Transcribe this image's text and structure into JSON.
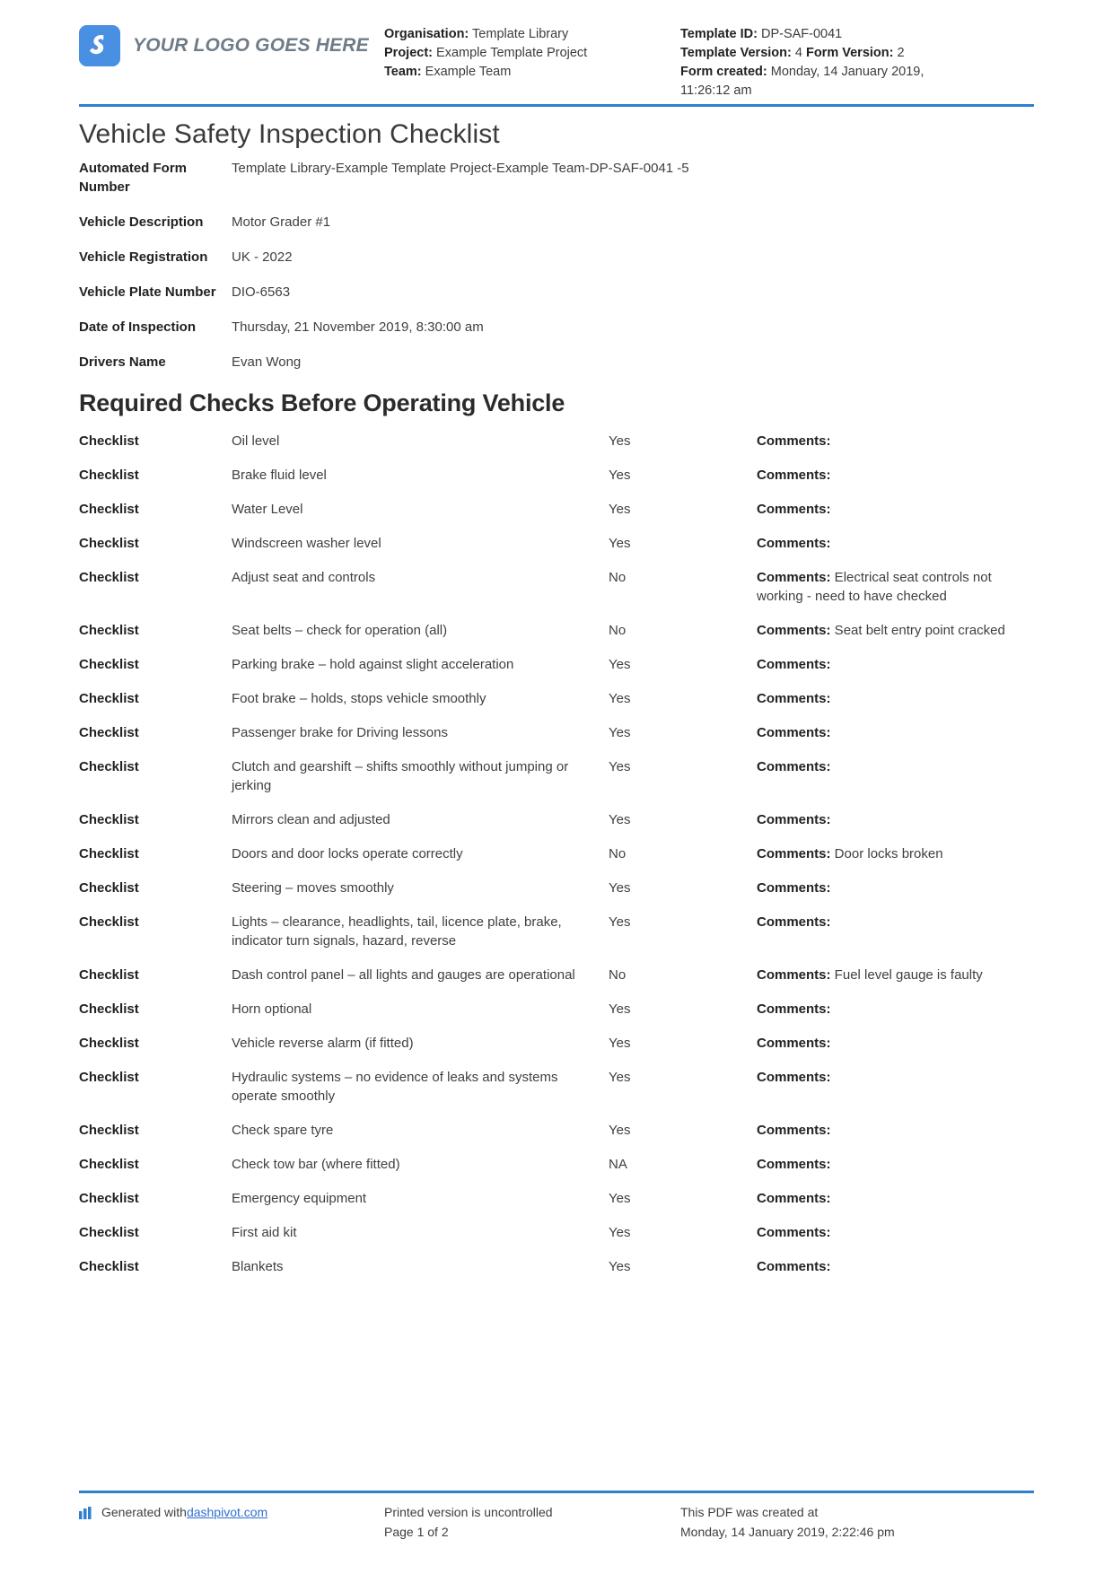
{
  "header": {
    "logo_text": "YOUR LOGO GOES HERE",
    "left_meta": [
      {
        "label": "Organisation:",
        "value": "Template Library"
      },
      {
        "label": "Project:",
        "value": "Example Template Project"
      },
      {
        "label": "Team:",
        "value": "Example Team"
      }
    ],
    "right_meta": [
      {
        "label": "Template ID:",
        "value": "DP-SAF-0041"
      },
      {
        "label": "Template Version:",
        "value": "4",
        "label2": "Form Version:",
        "value2": "2"
      },
      {
        "label": "Form created:",
        "value": "Monday, 14 January 2019, 11:26:12 am"
      }
    ]
  },
  "title": "Vehicle Safety Inspection Checklist",
  "fields": [
    {
      "label": "Automated Form Number",
      "value": "Template Library-Example Template Project-Example Team-DP-SAF-0041   -5"
    },
    {
      "label": "Vehicle Description",
      "value": "Motor Grader #1"
    },
    {
      "label": "Vehicle Registration",
      "value": "UK - 2022"
    },
    {
      "label": "Vehicle Plate Number",
      "value": "DIO-6563"
    },
    {
      "label": "Date of Inspection",
      "value": "Thursday, 21 November 2019, 8:30:00 am"
    },
    {
      "label": "Drivers Name",
      "value": "Evan Wong"
    }
  ],
  "section_heading": "Required Checks Before Operating Vehicle",
  "checklist_type_label": "Checklist",
  "comments_label": "Comments:",
  "checklist": [
    {
      "type": "Checklist",
      "item": "Oil level",
      "answer": "Yes",
      "comment": ""
    },
    {
      "type": "Checklist",
      "item": "Brake fluid level",
      "answer": "Yes",
      "comment": ""
    },
    {
      "type": "Checklist",
      "item": "Water Level",
      "answer": "Yes",
      "comment": ""
    },
    {
      "type": "Checklist",
      "item": "Windscreen washer level",
      "answer": "Yes",
      "comment": ""
    },
    {
      "type": "Checklist",
      "item": "Adjust seat and controls",
      "answer": "No",
      "comment": " Electrical seat controls not working - need to have checked"
    },
    {
      "type": "Checklist",
      "item": "Seat belts – check for operation (all)",
      "answer": "No",
      "comment": " Seat belt entry point cracked"
    },
    {
      "type": "Checklist",
      "item": "Parking brake – hold against slight acceleration",
      "answer": "Yes",
      "comment": ""
    },
    {
      "type": "Checklist",
      "item": "Foot brake – holds, stops vehicle smoothly",
      "answer": "Yes",
      "comment": ""
    },
    {
      "type": "Checklist",
      "item": "Passenger brake for Driving lessons",
      "answer": "Yes",
      "comment": ""
    },
    {
      "type": "Checklist",
      "item": "Clutch and gearshift – shifts smoothly without jumping or jerking",
      "answer": "Yes",
      "comment": ""
    },
    {
      "type": "Checklist",
      "item": "Mirrors clean and adjusted",
      "answer": "Yes",
      "comment": ""
    },
    {
      "type": "Checklist",
      "item": "Doors and door locks operate correctly",
      "answer": "No",
      "comment": " Door locks broken"
    },
    {
      "type": "Checklist",
      "item": "Steering – moves smoothly",
      "answer": "Yes",
      "comment": ""
    },
    {
      "type": "Checklist",
      "item": "Lights – clearance, headlights, tail, licence plate, brake, indicator turn signals, hazard, reverse",
      "answer": "Yes",
      "comment": ""
    },
    {
      "type": "Checklist",
      "item": "Dash control panel – all lights and gauges are operational",
      "answer": "No",
      "comment": " Fuel level gauge is faulty"
    },
    {
      "type": "Checklist",
      "item": "Horn optional",
      "answer": "Yes",
      "comment": ""
    },
    {
      "type": "Checklist",
      "item": "Vehicle reverse alarm (if fitted)",
      "answer": "Yes",
      "comment": ""
    },
    {
      "type": "Checklist",
      "item": "Hydraulic systems – no evidence of leaks and systems operate smoothly",
      "answer": "Yes",
      "comment": ""
    },
    {
      "type": "Checklist",
      "item": "Check spare tyre",
      "answer": "Yes",
      "comment": ""
    },
    {
      "type": "Checklist",
      "item": "Check tow bar (where fitted)",
      "answer": "NA",
      "comment": ""
    },
    {
      "type": "Checklist",
      "item": "Emergency equipment",
      "answer": "Yes",
      "comment": ""
    },
    {
      "type": "Checklist",
      "item": "First aid kit",
      "answer": "Yes",
      "comment": ""
    },
    {
      "type": "Checklist",
      "item": "Blankets",
      "answer": "Yes",
      "comment": ""
    }
  ],
  "footer": {
    "generated_prefix": "Generated with ",
    "generated_link": "dashpivot.com",
    "uncontrolled": "Printed version is uncontrolled",
    "page_number": "Page 1 of 2",
    "created_label": "This PDF was created at",
    "created_value": "Monday, 14 January 2019, 2:22:46 pm"
  },
  "colors": {
    "accent": "#2f7fd1",
    "logo_blue": "#4a90e2",
    "link": "#2f6fd0"
  }
}
